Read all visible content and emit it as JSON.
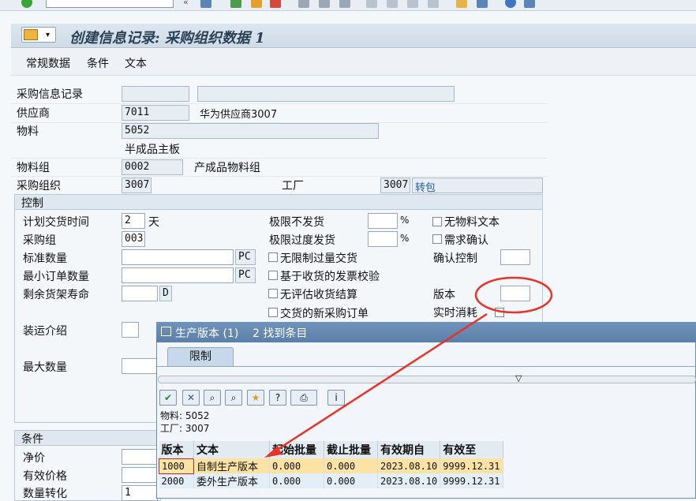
{
  "toolbar": {
    "icons": [
      "check-icon",
      "command-field",
      "back-icon",
      "save-icon",
      "exit-icon",
      "cancel-icon",
      "print-icon",
      "find-icon",
      "first-page-icon",
      "prev-page-icon",
      "next-page-icon",
      "last-page-icon",
      "new-session-icon",
      "shortcut-icon",
      "help-icon",
      "layout-icon"
    ]
  },
  "title": "创建信息记录: 采购组织数据 1",
  "menu": [
    "常规数据",
    "条件",
    "文本"
  ],
  "header": {
    "info_record_label": "采购信息记录",
    "vendor_label": "供应商",
    "vendor_value": "7011",
    "vendor_name": "华为供应商3007",
    "material_label": "物料",
    "material_value": "5052",
    "material_desc": "半成品主板",
    "matgroup_label": "物料组",
    "matgroup_value": "0002",
    "matgroup_desc": "产成品物料组",
    "porg_label": "采购组织",
    "porg_value": "3007",
    "plant_label": "工厂",
    "plant_value": "3007",
    "plant_desc": "转包"
  },
  "control": {
    "title": "控制",
    "planned_delivery_label": "计划交货时间",
    "planned_delivery_value": "2",
    "planned_delivery_unit": "天",
    "purch_group_label": "采购组",
    "purch_group_value": "003",
    "std_qty_label": "标准数量",
    "std_qty_unit": "PC",
    "min_qty_label": "最小订单数量",
    "min_qty_unit": "PC",
    "shelf_life_label": "剩余货架寿命",
    "shelf_life_unit": "D",
    "shipping_label": "装运介绍",
    "max_qty_label": "最大数量",
    "underdel_label": "极限不发货",
    "overdel_label": "极限过度发货",
    "percent": "%",
    "unlimited_label": "无限制过量交货",
    "gr_iv_label": "基于收货的发票校验",
    "no_ers_label": "无评估收货结算",
    "new_po_label": "交货的新采购订单",
    "no_mat_text_label": "无物料文本",
    "ack_req_label": "需求确认",
    "conf_ctrl_label": "确认控制",
    "version_label": "版本",
    "rt_consumption_label": "实时消耗"
  },
  "conditions": {
    "title": "条件",
    "net_price_label": "净价",
    "eff_price_label": "有效价格",
    "qty_conv_label": "数量转化",
    "qty_conv_value": "1"
  },
  "popup": {
    "title": "生产版本 (1)",
    "hits": "2 找到条目",
    "tab": "限制",
    "material_line": "物料: 5052",
    "plant_line": "工厂: 3007",
    "columns": [
      "版本",
      "文本",
      "起始批量",
      "截止批量",
      "有效期自",
      "有效至"
    ],
    "rows": [
      [
        "1000",
        "自制生产版本",
        "0.000",
        "0.000",
        "2023.08.10",
        "9999.12.31"
      ],
      [
        "2000",
        "委外生产版本",
        "0.000",
        "0.000",
        "2023.08.10",
        "9999.12.31"
      ]
    ]
  },
  "colors": {
    "annotation": "#e8322a",
    "selected_row": "#fde3a3",
    "popup_title": "#5b7fa8"
  }
}
